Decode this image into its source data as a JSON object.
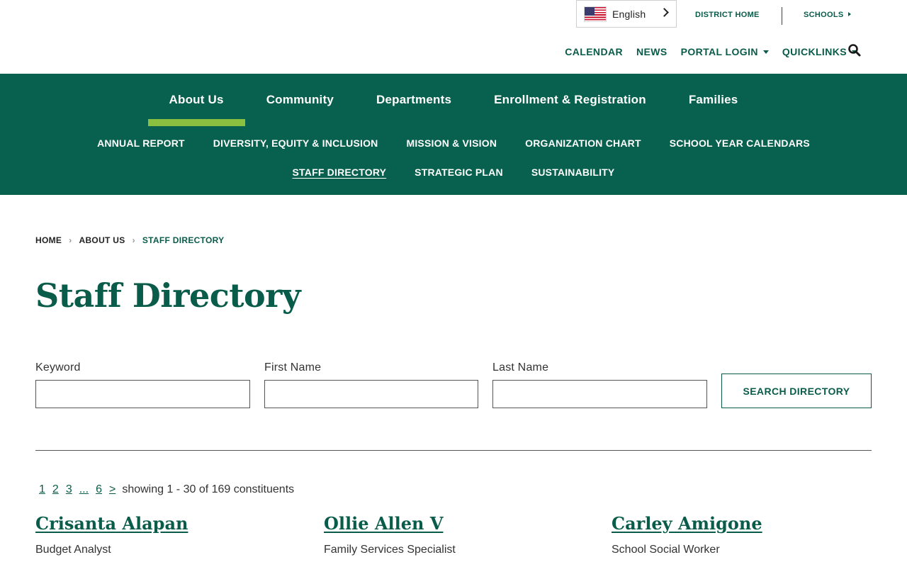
{
  "language": {
    "label": "English",
    "flag_icon": "us-flag-icon"
  },
  "utility_links": {
    "district_home": "DISTRICT HOME",
    "schools": "SCHOOLS"
  },
  "top_nav": {
    "calendar": "CALENDAR",
    "news": "NEWS",
    "portal_login": "PORTAL LOGIN",
    "quicklinks": "QUICKLINKS",
    "search_icon": "search-icon"
  },
  "primary_nav": [
    {
      "label": "About Us",
      "active": true
    },
    {
      "label": "Community",
      "active": false
    },
    {
      "label": "Departments",
      "active": false
    },
    {
      "label": "Enrollment & Registration",
      "active": false
    },
    {
      "label": "Families",
      "active": false
    }
  ],
  "sub_nav": {
    "row1": [
      "ANNUAL REPORT",
      "DIVERSITY, EQUITY & INCLUSION",
      "MISSION & VISION",
      "ORGANIZATION CHART",
      "SCHOOL YEAR CALENDARS"
    ],
    "row2": [
      "STAFF DIRECTORY",
      "STRATEGIC PLAN",
      "SUSTAINABILITY"
    ],
    "current": "STAFF DIRECTORY"
  },
  "breadcrumb": [
    "HOME",
    "ABOUT US",
    "STAFF DIRECTORY"
  ],
  "page_title": "Staff Directory",
  "search_form": {
    "keyword_label": "Keyword",
    "keyword_value": "",
    "first_name_label": "First Name",
    "first_name_value": "",
    "last_name_label": "Last Name",
    "last_name_value": "",
    "button_label": "SEARCH DIRECTORY"
  },
  "pagination": {
    "pages": [
      "1",
      "2",
      "3",
      "...",
      "6",
      ">"
    ],
    "summary": "showing 1 - 30 of 169 constituents"
  },
  "staff": [
    {
      "name": "Crisanta Alapan",
      "role": "Budget Analyst"
    },
    {
      "name": "Ollie Allen V",
      "role": "Family Services Specialist"
    },
    {
      "name": "Carley Amigone",
      "role": "School Social Worker"
    }
  ],
  "colors": {
    "brand_green": "#08604e",
    "accent_lime": "#8bbf3f",
    "text_green": "#0a5c4a"
  }
}
